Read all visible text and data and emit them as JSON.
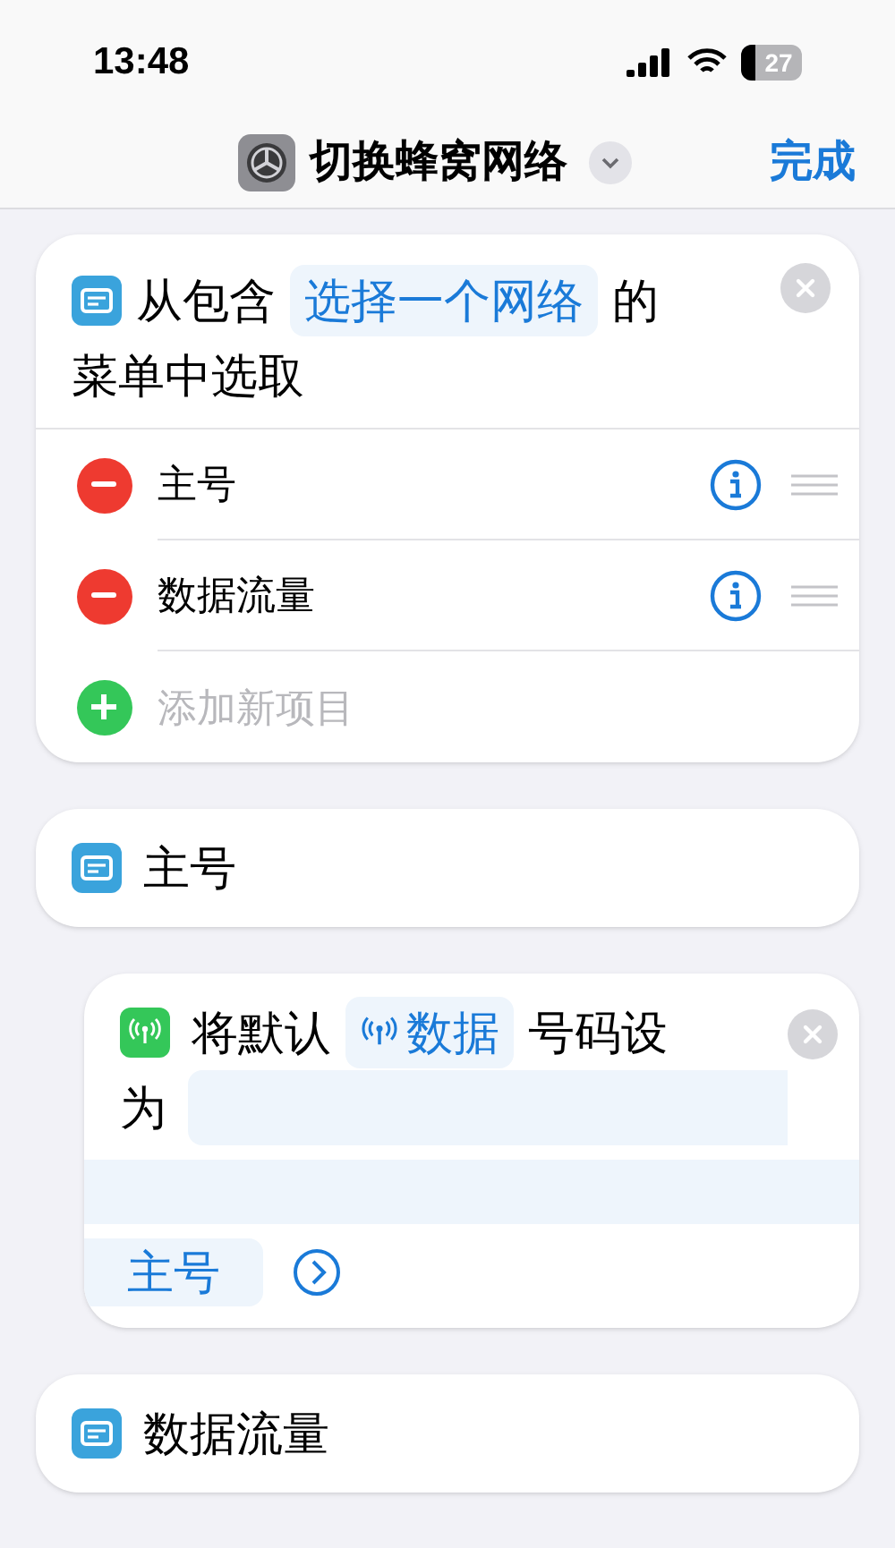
{
  "status_bar": {
    "time": "13:48",
    "battery": "27"
  },
  "nav": {
    "title": "切换蜂窝网络",
    "done": "完成"
  },
  "menu_action": {
    "lines": [
      [
        {
          "kind": "text",
          "text": "从包含"
        },
        {
          "kind": "token",
          "text": "选择一个网络"
        },
        {
          "kind": "text",
          "text": "的"
        }
      ],
      [
        {
          "kind": "text",
          "text": "菜单中选取"
        }
      ]
    ],
    "items": [
      {
        "kind": "item",
        "label": "主号"
      },
      {
        "kind": "item",
        "label": "数据流量"
      },
      {
        "kind": "add",
        "label": "添加新项目"
      }
    ]
  },
  "blocks": [
    {
      "kind": "case",
      "label": "主号"
    },
    {
      "kind": "action",
      "lines": [
        [
          {
            "kind": "text",
            "text": "将默认"
          },
          {
            "kind": "token",
            "text": "数据",
            "icon": true
          },
          {
            "kind": "text",
            "text": "号码设"
          }
        ],
        [
          {
            "kind": "text",
            "text": "为"
          },
          {
            "kind": "field"
          }
        ]
      ],
      "value": "主号"
    },
    {
      "kind": "case",
      "label": "数据流量"
    }
  ]
}
